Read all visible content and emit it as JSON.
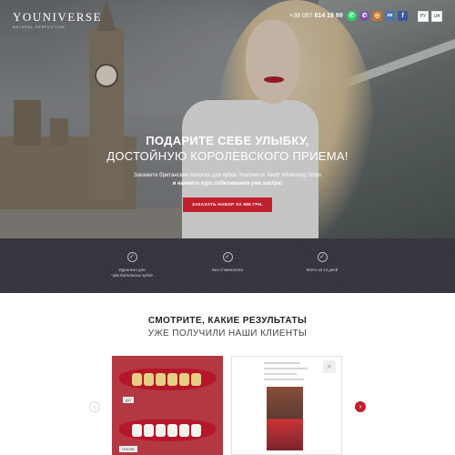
{
  "brand": {
    "name": "YOUNIVERSE",
    "tagline": "NATURAL PERFECTION"
  },
  "header": {
    "phone_prefix": "+38 067",
    "phone_number": "814 19 99",
    "social_icons": [
      {
        "name": "whatsapp-icon",
        "glyph": "✆",
        "color": "#25d366"
      },
      {
        "name": "viber-icon",
        "glyph": "✆",
        "color": "#7b519d"
      },
      {
        "name": "instagram-icon",
        "glyph": "◎",
        "color": "#c1762e"
      },
      {
        "name": "vk-icon",
        "glyph": "вк",
        "color": "#4a76a8"
      },
      {
        "name": "facebook-icon",
        "glyph": "f",
        "color": "#3b5998"
      }
    ],
    "languages": [
      "РУ",
      "UA"
    ]
  },
  "hero": {
    "title_line1": "ПОДАРИТЕ СЕБЕ УЛЫБКУ,",
    "title_line2": "ДОСТОЙНУЮ КОРОЛЕВСКОГО ПРИЕМА!",
    "subtitle_line1": "Закажите британские полоски для зубов Youniverse Teeth Whitening Strips",
    "subtitle_line2": "и начните курс отбеливания уже завтра!",
    "cta_label": "ЗАКАЗАТЬ НАБОР ЗА 988 ГРН."
  },
  "features": [
    {
      "line1": "Идеально для",
      "line2": "чувствительных зубов"
    },
    {
      "line1": "Без стоматолога",
      "line2": ""
    },
    {
      "line1": "Всего за 14 дней",
      "line2": ""
    }
  ],
  "results": {
    "title_line1": "СМОТРИТЕ, КАКИЕ РЕЗУЛЬТАТЫ",
    "title_line2": "УЖЕ ПОЛУЧИЛИ НАШИ КЛИЕНТЫ",
    "before_label": "ДО",
    "after_label": "ПОСЛЕ"
  },
  "colors": {
    "accent": "#c1202f",
    "band": "#34333c"
  }
}
